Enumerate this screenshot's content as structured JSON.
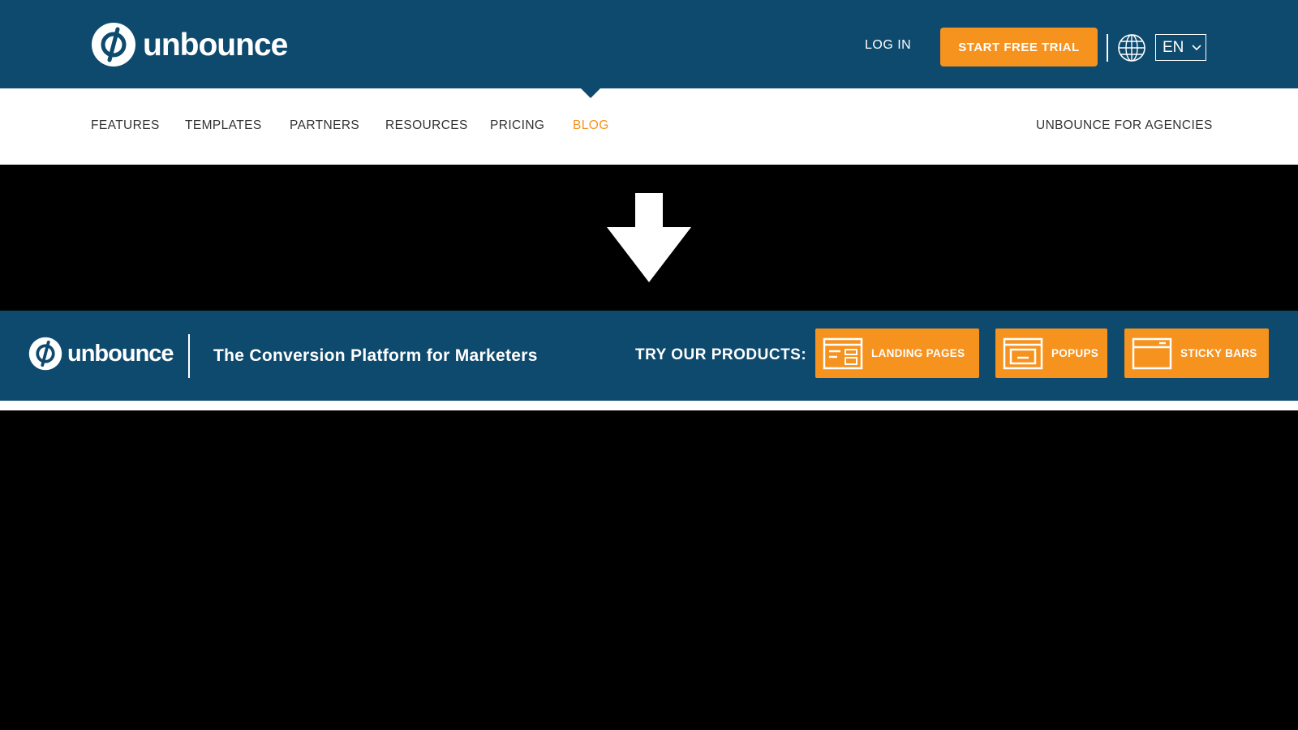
{
  "header": {
    "brand": "unbounce",
    "login_label": "LOG IN",
    "trial_label": "START FREE TRIAL",
    "language": "EN"
  },
  "nav": {
    "items": [
      {
        "label": "FEATURES"
      },
      {
        "label": "TEMPLATES"
      },
      {
        "label": "PARTNERS"
      },
      {
        "label": "RESOURCES"
      },
      {
        "label": "PRICING"
      },
      {
        "label": "BLOG"
      }
    ],
    "agencies_label": "UNBOUNCE FOR AGENCIES"
  },
  "banner": {
    "brand": "unbounce",
    "tagline": "The Conversion Platform for Marketers",
    "try_label": "TRY OUR PRODUCTS:",
    "products": [
      {
        "label": "LANDING PAGES",
        "icon": "landing-page-icon"
      },
      {
        "label": "POPUPS",
        "icon": "popup-icon"
      },
      {
        "label": "STICKY BARS",
        "icon": "sticky-bar-icon"
      }
    ]
  },
  "colors": {
    "brand_blue": "#0e4a6e",
    "accent_orange": "#f6921e",
    "background": "#000000"
  }
}
